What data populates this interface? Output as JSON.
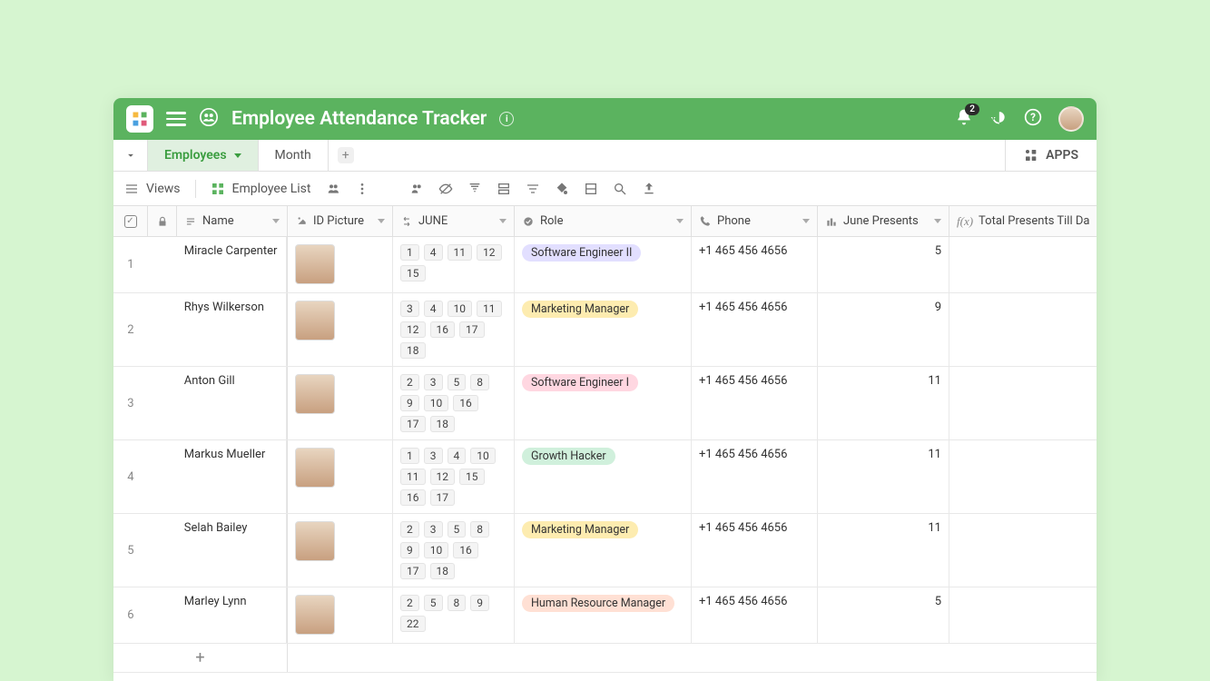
{
  "header": {
    "title": "Employee Attendance Tracker",
    "notification_count": "2"
  },
  "tabs": {
    "items": [
      {
        "label": "Employees",
        "active": true
      },
      {
        "label": "Month",
        "active": false
      }
    ],
    "apps_label": "APPS"
  },
  "toolbar": {
    "views_label": "Views",
    "current_view": "Employee List"
  },
  "columns": {
    "name": "Name",
    "picture": "ID Picture",
    "june": "JUNE",
    "role": "Role",
    "phone": "Phone",
    "june_presents": "June Presents",
    "total_presents": "Total Presents Till Dat"
  },
  "role_colors": {
    "Software Engineer II": "#e2dfff",
    "Marketing Manager": "#fdecb0",
    "Software Engineer I": "#ffd7e1",
    "Growth Hacker": "#d0f0dc",
    "Human Resource Manager": "#ffe0d4"
  },
  "rows": [
    {
      "num": "1",
      "name": "Miracle Carpenter",
      "days": [
        "1",
        "4",
        "11",
        "12",
        "15"
      ],
      "role": "Software Engineer II",
      "phone": "+1 465 456 4656",
      "jp": "5"
    },
    {
      "num": "2",
      "name": "Rhys Wilkerson",
      "days": [
        "3",
        "4",
        "10",
        "11",
        "12",
        "16",
        "17",
        "18"
      ],
      "role": "Marketing Manager",
      "phone": "+1 465 456 4656",
      "jp": "9"
    },
    {
      "num": "3",
      "name": "Anton Gill",
      "days": [
        "2",
        "3",
        "5",
        "8",
        "9",
        "10",
        "16",
        "17",
        "18"
      ],
      "role": "Software Engineer I",
      "phone": "+1 465 456 4656",
      "jp": "11"
    },
    {
      "num": "4",
      "name": "Markus Mueller",
      "days": [
        "1",
        "3",
        "4",
        "10",
        "11",
        "12",
        "15",
        "16",
        "17"
      ],
      "role": "Growth Hacker",
      "phone": "+1 465 456 4656",
      "jp": "11"
    },
    {
      "num": "5",
      "name": "Selah Bailey",
      "days": [
        "2",
        "3",
        "5",
        "8",
        "9",
        "10",
        "16",
        "17",
        "18"
      ],
      "role": "Marketing Manager",
      "phone": "+1 465 456 4656",
      "jp": "11"
    },
    {
      "num": "6",
      "name": "Marley Lynn",
      "days": [
        "2",
        "5",
        "8",
        "9",
        "22"
      ],
      "role": "Human Resource Manager",
      "phone": "+1 465 456 4656",
      "jp": "5"
    }
  ]
}
